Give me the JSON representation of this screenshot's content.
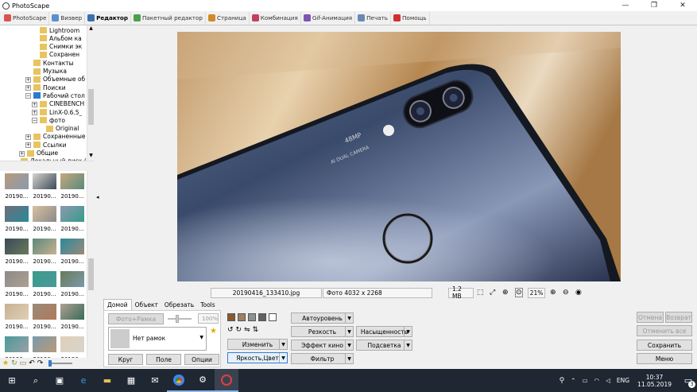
{
  "window": {
    "title": "PhotoScape",
    "minimize": "—",
    "maximize": "❐",
    "close": "✕"
  },
  "tabs": [
    {
      "label": "PhotoScape",
      "color": "#d9534f"
    },
    {
      "label": "Визвер",
      "color": "#5a8fd0"
    },
    {
      "label": "Редактор",
      "color": "#3a6fb0",
      "active": true
    },
    {
      "label": "Пакетный редактор",
      "color": "#4d9e4d"
    },
    {
      "label": "Страница",
      "color": "#d08a2a"
    },
    {
      "label": "Комбинация",
      "color": "#c04060"
    },
    {
      "label": "Gif-Анимация",
      "color": "#7a55b5"
    },
    {
      "label": "Печать",
      "color": "#6a8ab0"
    },
    {
      "label": "Помощь",
      "color": "#d03030"
    }
  ],
  "tree": [
    {
      "label": "Lightroom",
      "indent": 3
    },
    {
      "label": "Альбом ка",
      "indent": 3
    },
    {
      "label": "Снимки эк",
      "indent": 3
    },
    {
      "label": "Сохранен",
      "indent": 3
    },
    {
      "label": "Контакты",
      "indent": 2
    },
    {
      "label": "Музыка",
      "indent": 2
    },
    {
      "label": "Объемные об",
      "indent": 2
    },
    {
      "label": "Поиски",
      "indent": 2
    },
    {
      "label": "Рабочий стол",
      "indent": 2
    },
    {
      "label": "CINEBENCH",
      "indent": 3
    },
    {
      "label": "LinX-0.6.5_",
      "indent": 3
    },
    {
      "label": "фото",
      "indent": 3
    },
    {
      "label": "Original",
      "indent": 4
    },
    {
      "label": "Сохраненные",
      "indent": 2
    },
    {
      "label": "Ссылки",
      "indent": 2
    },
    {
      "label": "Общие",
      "indent": 1
    },
    {
      "label": "Локальный диск (D:)",
      "indent": 0
    }
  ],
  "thumbnails": {
    "caption": "20190..."
  },
  "thumb_colors": [
    "#b89a7a",
    "#d8d4cc",
    "#c7a77e",
    "#6e6e7a",
    "#d8c0a0",
    "#8a9ab0",
    "#3a4a5a",
    "#5a8a7a",
    "#2a8a9a",
    "#8a8a8a",
    "#3a9a8a",
    "#6a7a5a",
    "#c8b090",
    "#9a8a7a",
    "#b0a090",
    "#4a9a9a",
    "#7a9aaa",
    "#e0d0b8",
    "#b07a5a",
    "#3a6a5a",
    "#9aa0a8"
  ],
  "status": {
    "filename": "20190416_133410.jpg",
    "dimensions": "Фото 4032 x 2268",
    "filesize": "1.2 MB",
    "zoom": "21%"
  },
  "editor": {
    "tabs": [
      "Домой",
      "Объект",
      "Обрезать",
      "Tools"
    ],
    "frame_button": "Фото+Рамка",
    "opacity": "100%",
    "frame_select": "Нет рамок",
    "round": "Круг",
    "field": "Поле",
    "options": "Опции",
    "resize": "Изменить",
    "brightness": "Яркость,Цвет",
    "autolevel": "Автоуровень",
    "sharpen": "Резкость",
    "film_effect": "Эффект кино",
    "filter": "Фильтр",
    "saturation": "Насыщенность",
    "backlight": "Подсветка",
    "undo": "Отмена",
    "redo": "Возврат",
    "undo_all": "Отменить все",
    "save": "Сохранить",
    "menu": "Меню"
  },
  "taskbar": {
    "lang": "ENG",
    "time": "10:37",
    "date": "11.05.2019",
    "notifications": "3"
  }
}
